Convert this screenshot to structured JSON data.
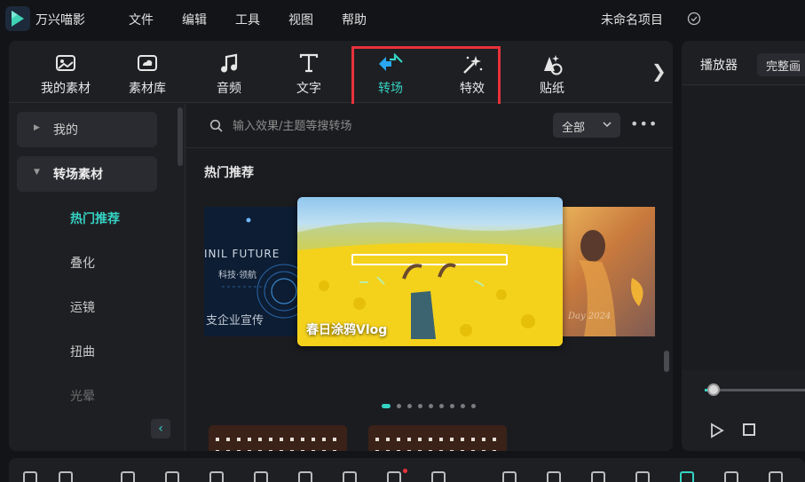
{
  "title_bar": {
    "app_name": "万兴喵影",
    "menu": [
      "文件",
      "编辑",
      "工具",
      "视图",
      "帮助"
    ],
    "project_name": "未命名项目",
    "status_icon": "check-circle-icon"
  },
  "tool_tabs": [
    {
      "label": "我的素材",
      "icon": "image-folder-icon"
    },
    {
      "label": "素材库",
      "icon": "cloud-library-icon"
    },
    {
      "label": "音频",
      "icon": "music-note-icon"
    },
    {
      "label": "文字",
      "icon": "text-t-icon"
    },
    {
      "label": "转场",
      "icon": "transition-arrows-icon",
      "active": true
    },
    {
      "label": "特效",
      "icon": "sparkle-wand-icon",
      "active": true
    },
    {
      "label": "贴纸",
      "icon": "sticker-icon"
    }
  ],
  "tabs_next_glyph": "❯",
  "sidebar": {
    "categories": [
      {
        "label": "我的",
        "expanded": false
      },
      {
        "label": "转场素材",
        "expanded": true
      }
    ],
    "subitems": [
      {
        "label": "热门推荐",
        "active": true
      },
      {
        "label": "叠化",
        "active": false
      },
      {
        "label": "运镜",
        "active": false
      },
      {
        "label": "扭曲",
        "active": false
      },
      {
        "label": "光晕",
        "active": false
      }
    ],
    "collapse_glyph": "‹"
  },
  "search": {
    "placeholder": "输入效果/主题等搜转场",
    "filter_value": "全部",
    "more_glyph": "•••"
  },
  "section_title": "热门推荐",
  "carousel": {
    "main_title": "春日涂鸦Vlog",
    "left_title": "支企业宣传",
    "left_tag": "INIL FUTURE",
    "left_sub": "科技·领航",
    "right_caption": "Day 2024",
    "page_count": 9,
    "active_index": 0
  },
  "player": {
    "tab_label": "播放器",
    "quality_label": "完整画",
    "progress": 0.0
  },
  "colors": {
    "accent": "#35d3c3",
    "highlight_border": "#e8323a",
    "panel_bg": "#1e1f23",
    "app_bg": "#131418"
  }
}
